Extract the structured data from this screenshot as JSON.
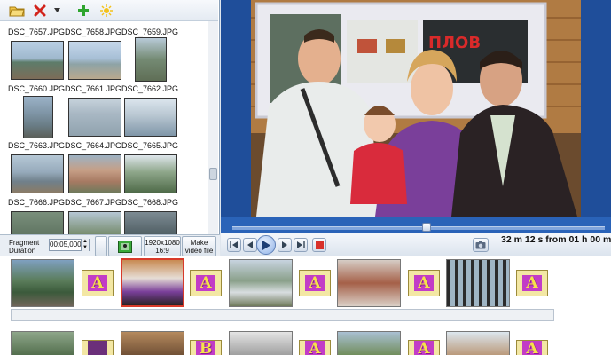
{
  "toolbar": {
    "icons": [
      "open-folder-icon",
      "delete-icon",
      "dropdown-arrow-icon",
      "add-icon",
      "effects-star-icon"
    ]
  },
  "gallery": {
    "items": [
      {
        "name": "DSC_7657.JPG"
      },
      {
        "name": "DSC_7658.JPG"
      },
      {
        "name": "DSC_7659.JPG"
      },
      {
        "name": "DSC_7660.JPG"
      },
      {
        "name": "DSC_7661.JPG"
      },
      {
        "name": "DSC_7662.JPG"
      },
      {
        "name": "DSC_7663.JPG"
      },
      {
        "name": "DSC_7664.JPG"
      },
      {
        "name": "DSC_7665.JPG"
      },
      {
        "name": "DSC_7666.JPG"
      },
      {
        "name": "DSC_7667.JPG"
      },
      {
        "name": "DSC_7668.JPG"
      }
    ]
  },
  "settings": {
    "fragment_label": "Fragment",
    "duration_label": "Duration",
    "duration_value": "00:05,000",
    "resolution_line1": "1920x1080",
    "resolution_line2": "16:9",
    "make_video_line1": "Make",
    "make_video_line2": "video file"
  },
  "player": {
    "time_readout": "32 m 12 s   from 01 h 00 m",
    "progress": 0.53
  },
  "storyboard": {
    "transition_letters": [
      "A",
      "A",
      "A",
      "A",
      "A",
      "A",
      "A",
      "A",
      "B",
      "A",
      "A",
      "A",
      "A"
    ],
    "colors": {
      "selection": "#d83a2a",
      "transition_bg": "#f3e7a4",
      "transition_tile": "#c23cc7",
      "transition_letter": "#f6e24a"
    }
  },
  "colors": {
    "preview_bg": "#1f4e9a",
    "panel_bg": "#dfe6ee"
  }
}
